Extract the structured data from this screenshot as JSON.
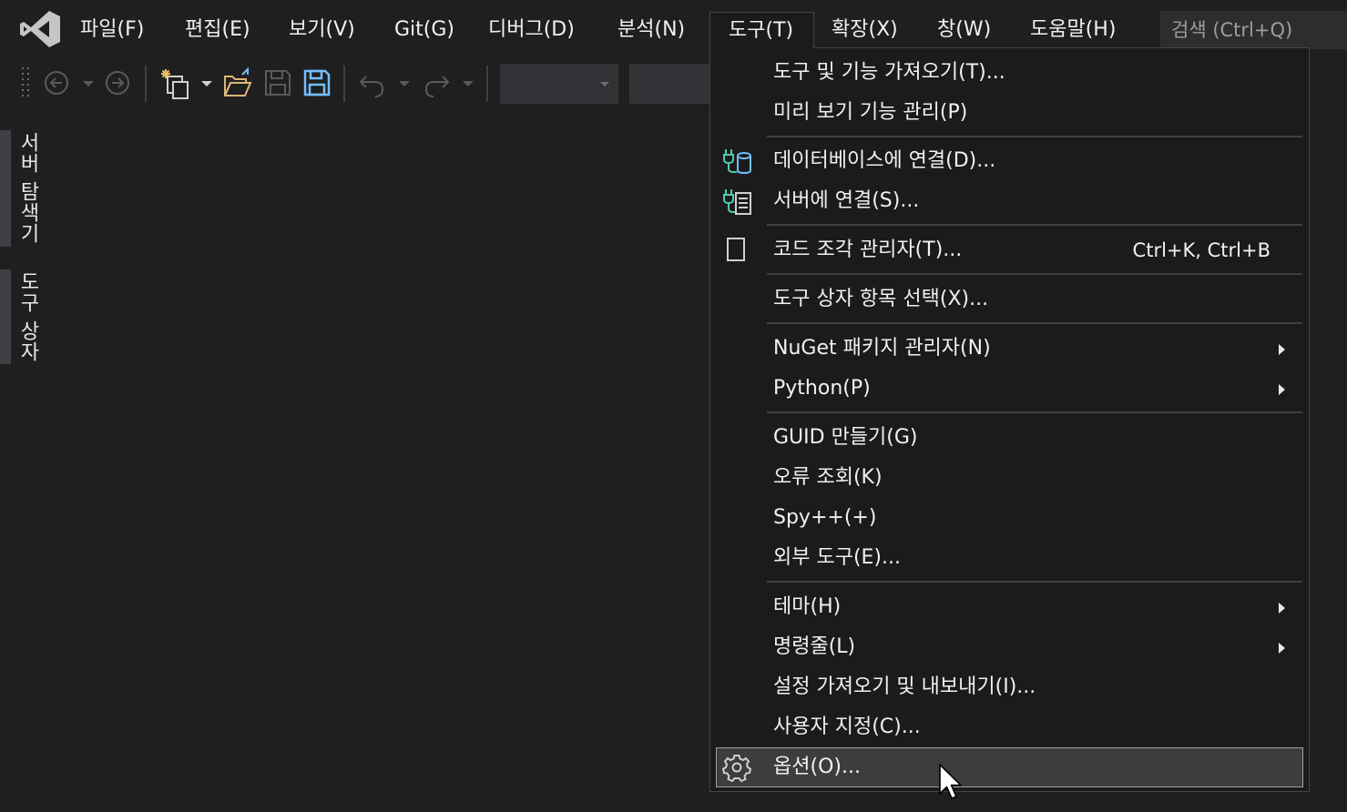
{
  "menubar": {
    "items": [
      "파일(F)",
      "편집(E)",
      "보기(V)",
      "Git(G)",
      "디버그(D)",
      "분석(N)",
      "도구(T)",
      "확장(X)",
      "창(W)",
      "도움말(H)"
    ],
    "search_placeholder": "검색 (Ctrl+Q)"
  },
  "side_tabs": [
    "서버 탐색기",
    "도구 상자"
  ],
  "tools_menu": {
    "items": [
      {
        "label": "도구 및 기능 가져오기(T)...",
        "icon": null
      },
      {
        "label": "미리 보기 기능 관리(P)",
        "icon": null
      },
      {
        "label": "데이터베이스에 연결(D)...",
        "icon": "database-connect-icon"
      },
      {
        "label": "서버에 연결(S)...",
        "icon": "server-connect-icon"
      },
      {
        "label": "코드 조각 관리자(T)...",
        "icon": "code-snippet-icon",
        "shortcut": "Ctrl+K, Ctrl+B"
      },
      {
        "label": "도구 상자 항목 선택(X)...",
        "icon": null
      },
      {
        "label": "NuGet 패키지 관리자(N)",
        "icon": null,
        "submenu": true
      },
      {
        "label": "Python(P)",
        "icon": null,
        "submenu": true
      },
      {
        "label": "GUID 만들기(G)",
        "icon": null
      },
      {
        "label": "오류 조회(K)",
        "icon": null
      },
      {
        "label": "Spy++(+)",
        "icon": null
      },
      {
        "label": "외부 도구(E)...",
        "icon": null
      },
      {
        "label": "테마(H)",
        "icon": null,
        "submenu": true
      },
      {
        "label": "명령줄(L)",
        "icon": null,
        "submenu": true
      },
      {
        "label": "설정 가져오기 및 내보내기(I)...",
        "icon": null
      },
      {
        "label": "사용자 지정(C)...",
        "icon": null
      },
      {
        "label": "옵션(O)...",
        "icon": "gear-icon",
        "highlighted": true
      }
    ]
  },
  "colors": {
    "background": "#1f1f1f",
    "menu_background": "#1b1b1c",
    "highlight": "#3d3d3d",
    "accent_blue": "#75beff",
    "folder_yellow": "#dcb67a"
  }
}
